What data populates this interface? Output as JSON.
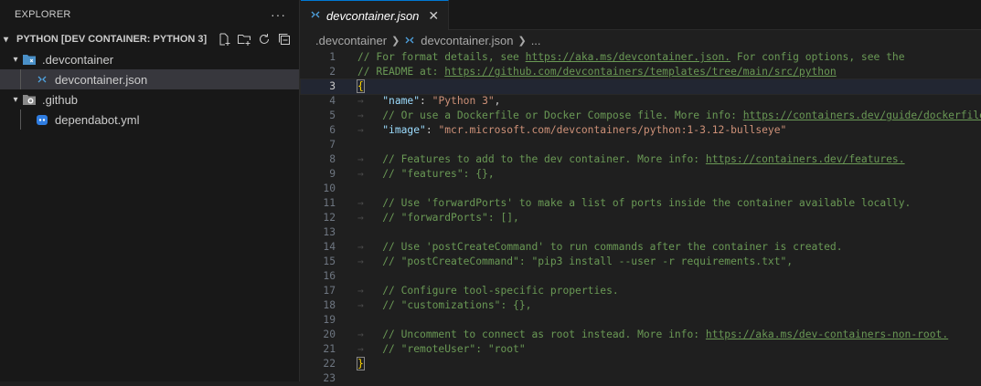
{
  "explorer": {
    "title": "EXPLORER",
    "more": "···",
    "workspace": "PYTHON [DEV CONTAINER: PYTHON 3]",
    "tree": [
      {
        "label": ".devcontainer",
        "kind": "folder",
        "icon": "devcontainer-folder-icon"
      },
      {
        "label": "devcontainer.json",
        "kind": "file",
        "icon": "remote-json-icon",
        "selected": true
      },
      {
        "label": ".github",
        "kind": "folder",
        "icon": "github-folder-icon"
      },
      {
        "label": "dependabot.yml",
        "kind": "file",
        "icon": "dependabot-icon"
      }
    ]
  },
  "editor": {
    "tab_label": "devcontainer.json",
    "breadcrumb": {
      "folder": ".devcontainer",
      "file": "devcontainer.json",
      "more": "..."
    },
    "current_line": 3,
    "lines": [
      "// For format details, see https://aka.ms/devcontainer.json. For config options, see the",
      "// README at: https://github.com/devcontainers/templates/tree/main/src/python",
      "{",
      "\t\"name\": \"Python 3\",",
      "\t// Or use a Dockerfile or Docker Compose file. More info: https://containers.dev/guide/dockerfile",
      "\t\"image\": \"mcr.microsoft.com/devcontainers/python:1-3.12-bullseye\"",
      "",
      "\t// Features to add to the dev container. More info: https://containers.dev/features.",
      "\t// \"features\": {},",
      "",
      "\t// Use 'forwardPorts' to make a list of ports inside the container available locally.",
      "\t// \"forwardPorts\": [],",
      "",
      "\t// Use 'postCreateCommand' to run commands after the container is created.",
      "\t// \"postCreateCommand\": \"pip3 install --user -r requirements.txt\",",
      "",
      "\t// Configure tool-specific properties.",
      "\t// \"customizations\": {},",
      "",
      "\t// Uncomment to connect as root instead. More info: https://aka.ms/dev-containers-non-root.",
      "\t// \"remoteUser\": \"root\"",
      "}",
      ""
    ]
  },
  "colors": {
    "accent": "#0078d4",
    "comment": "#6a9955",
    "key": "#9cdcfe",
    "string": "#ce9178",
    "brace": "#ffd700"
  }
}
